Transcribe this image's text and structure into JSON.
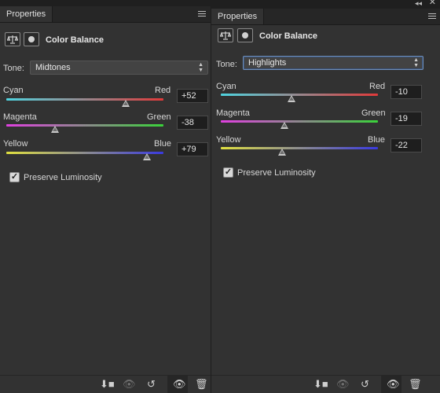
{
  "left": {
    "tab_label": "Properties",
    "title": "Color Balance",
    "tone_label": "Tone:",
    "tone_value": "Midtones",
    "sliders": [
      {
        "left": "Cyan",
        "right": "Red",
        "value": "+52",
        "amount": 52
      },
      {
        "left": "Magenta",
        "right": "Green",
        "value": "-38",
        "amount": -38
      },
      {
        "left": "Yellow",
        "right": "Blue",
        "value": "+79",
        "amount": 79
      }
    ],
    "preserve_label": "Preserve Luminosity",
    "preserve_checked": true
  },
  "right": {
    "tab_label": "Properties",
    "title": "Color Balance",
    "tone_label": "Tone:",
    "tone_value": "Highlights",
    "sliders": [
      {
        "left": "Cyan",
        "right": "Red",
        "value": "-10",
        "amount": -10
      },
      {
        "left": "Magenta",
        "right": "Green",
        "value": "-19",
        "amount": -19
      },
      {
        "left": "Yellow",
        "right": "Blue",
        "value": "-22",
        "amount": -22
      }
    ],
    "preserve_label": "Preserve Luminosity",
    "preserve_checked": true
  },
  "window": {
    "collapse_glyph": "◂◂",
    "close_glyph": "✕"
  },
  "icons": {
    "balance": "balance-scale-icon",
    "mask": "layer-mask-icon",
    "clip": "clip-to-layer-icon",
    "view_previous": "view-previous-state-icon",
    "reset": "reset-icon",
    "visibility": "eye-icon",
    "delete": "trash-icon",
    "menu": "panel-menu-icon"
  },
  "colors": {
    "panel_bg": "#323232",
    "cyan_red": [
      "#4fd4e0",
      "#e03a3a"
    ],
    "magenta_green": [
      "#e040e0",
      "#3ad23a"
    ],
    "yellow_blue": [
      "#e0e040",
      "#3a3ae0"
    ]
  }
}
